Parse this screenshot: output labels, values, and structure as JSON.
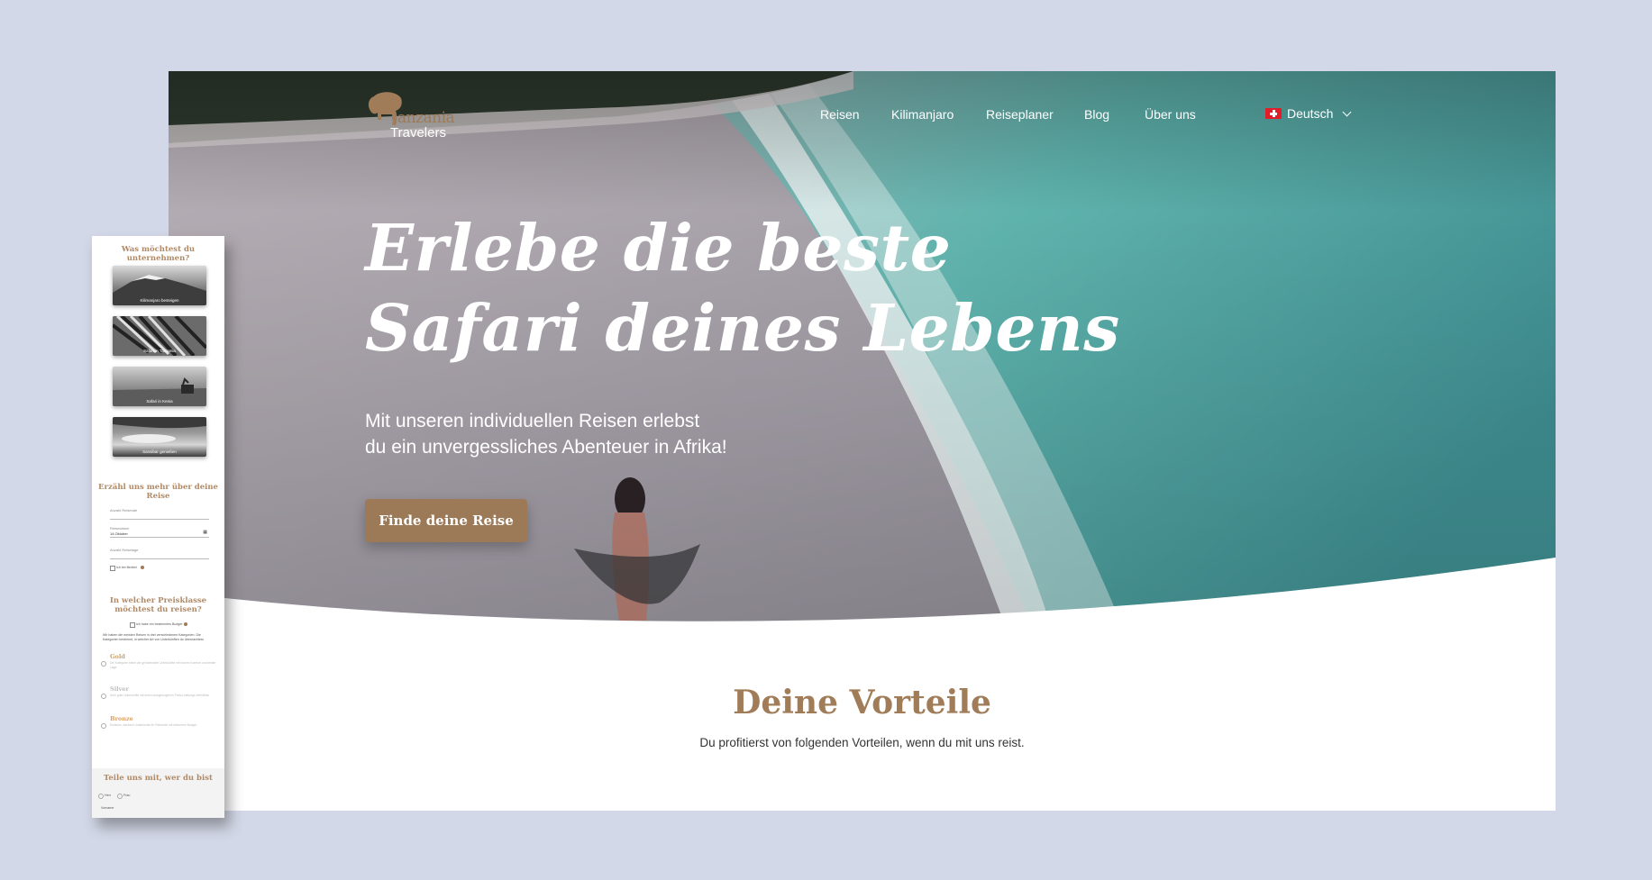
{
  "brand": {
    "logo_word_1": "anzania",
    "logo_word_2": "Travelers"
  },
  "nav": {
    "items": [
      "Reisen",
      "Kilimanjaro",
      "Reiseplaner",
      "Blog",
      "Über uns"
    ]
  },
  "language": {
    "label": "Deutsch",
    "flag_icon": "swiss-flag-icon"
  },
  "hero": {
    "headline": [
      "Erlebe die beste",
      "Safari deines Lebens"
    ],
    "subline": [
      "Mit unseren individuellen Reisen erlebst",
      "du ein unvergessliches Abenteuer in Afrika!"
    ],
    "cta_label": "Finde deine Reise"
  },
  "benefits": {
    "title": "Deine Vorteile",
    "subtitle": "Du profitierst von folgenden Vorteilen, wenn du mit uns reist."
  },
  "form_panel": {
    "q1": "Was möchtest du unternehmen?",
    "tiles": [
      {
        "label": "Kilimanjaro besteigen"
      },
      {
        "label": "Safari in Tansania"
      },
      {
        "label": "Safari in Kenia"
      },
      {
        "label": "Sansibar genießen"
      }
    ],
    "q2": "Erzähl uns mehr über deine Reise",
    "fields": [
      {
        "label": "Anzahl Reisende",
        "value": ""
      },
      {
        "label": "Reisedatum",
        "value": "14.Oktober"
      },
      {
        "label": "Anzahl Reisetage",
        "value": ""
      }
    ],
    "flexible_label": "Ich bin flexibel",
    "q3": "In welcher Preisklasse möchtest du reisen?",
    "budget_label": "Ich habe ein bestimmtes Budget",
    "tiers_intro": "Wir haben die meisten Reisen in drei verschiedenen Kategorien. Die Kategorien bestimmt, in welcher Art von Unterkünften du übernachtest.",
    "tiers": [
      {
        "name": "Gold",
        "color": "#c9a36f",
        "text": "Die Kategorie bietet die gehobensten Unterkünfte mit hohem Komfort und bester Lage."
      },
      {
        "name": "Silver",
        "color": "#bdbdbd",
        "text": "Sehr gute Unterkünfte mit einem ausgewogenen Preis-Leistungs-Verhältnis."
      },
      {
        "name": "Bronze",
        "color": "#d9a36a",
        "text": "Einfache, saubere Unterkünfte für Reisende mit kleinerem Budget."
      }
    ],
    "q4": "Teile uns mit, wer du bist",
    "salutations": [
      "Herr",
      "Frau"
    ],
    "first_name_label": "Vorname"
  }
}
